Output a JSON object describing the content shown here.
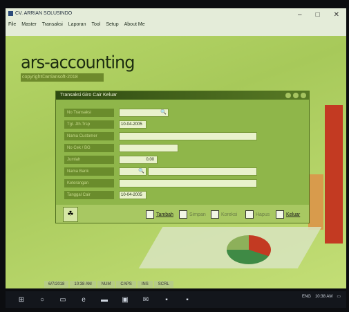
{
  "app": {
    "title": "CV. ARRIAN SOLUSINDO",
    "menu": [
      "File",
      "Master",
      "Transaksi",
      "Laporan",
      "Tool",
      "Setup",
      "About Me"
    ],
    "controls": [
      "–",
      "□",
      "✕"
    ]
  },
  "brand": {
    "name": "ars-accounting",
    "copyright": "copyright©arriansoft-2018"
  },
  "dialog": {
    "title": "Transaksi Giro Cair Keluar",
    "fields": [
      {
        "label": "No Transaksi",
        "value": ""
      },
      {
        "label": "Tgl. Jth.Trsp",
        "value": "10-04-2005"
      },
      {
        "label": "Nama Customer",
        "value": ""
      },
      {
        "label": "No Cek / BG",
        "value": ""
      },
      {
        "label": "Jumlah",
        "value": "0,00"
      },
      {
        "label": "Nama Bank",
        "value": ""
      },
      {
        "label": "Keterangan",
        "value": ""
      },
      {
        "label": "Tanggal Cair",
        "value": "10-04-2005"
      }
    ],
    "toolbar": [
      "Tambah",
      "Simpan",
      "Koreksi",
      "Hapus",
      "Keluar"
    ]
  },
  "status": [
    "6/7/2018",
    "10:38 AM",
    "NUM",
    "CAPS",
    "INS",
    "SCRL"
  ],
  "tray": {
    "lang": "ENG",
    "time": "10:38 AM"
  }
}
